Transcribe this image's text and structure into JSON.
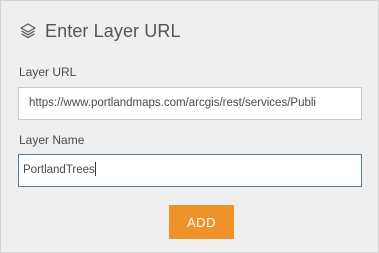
{
  "header": {
    "icon": "layers-icon",
    "title": "Enter Layer URL"
  },
  "fields": {
    "url_label": "Layer URL",
    "url_value": "https://www.portlandmaps.com/arcgis/rest/services/Publi",
    "name_label": "Layer Name",
    "name_value": "PortlandTrees"
  },
  "actions": {
    "add_label": "ADD"
  },
  "colors": {
    "panel_bg": "#efefef",
    "accent": "#f0922c",
    "focus_border": "#5a7c95"
  }
}
